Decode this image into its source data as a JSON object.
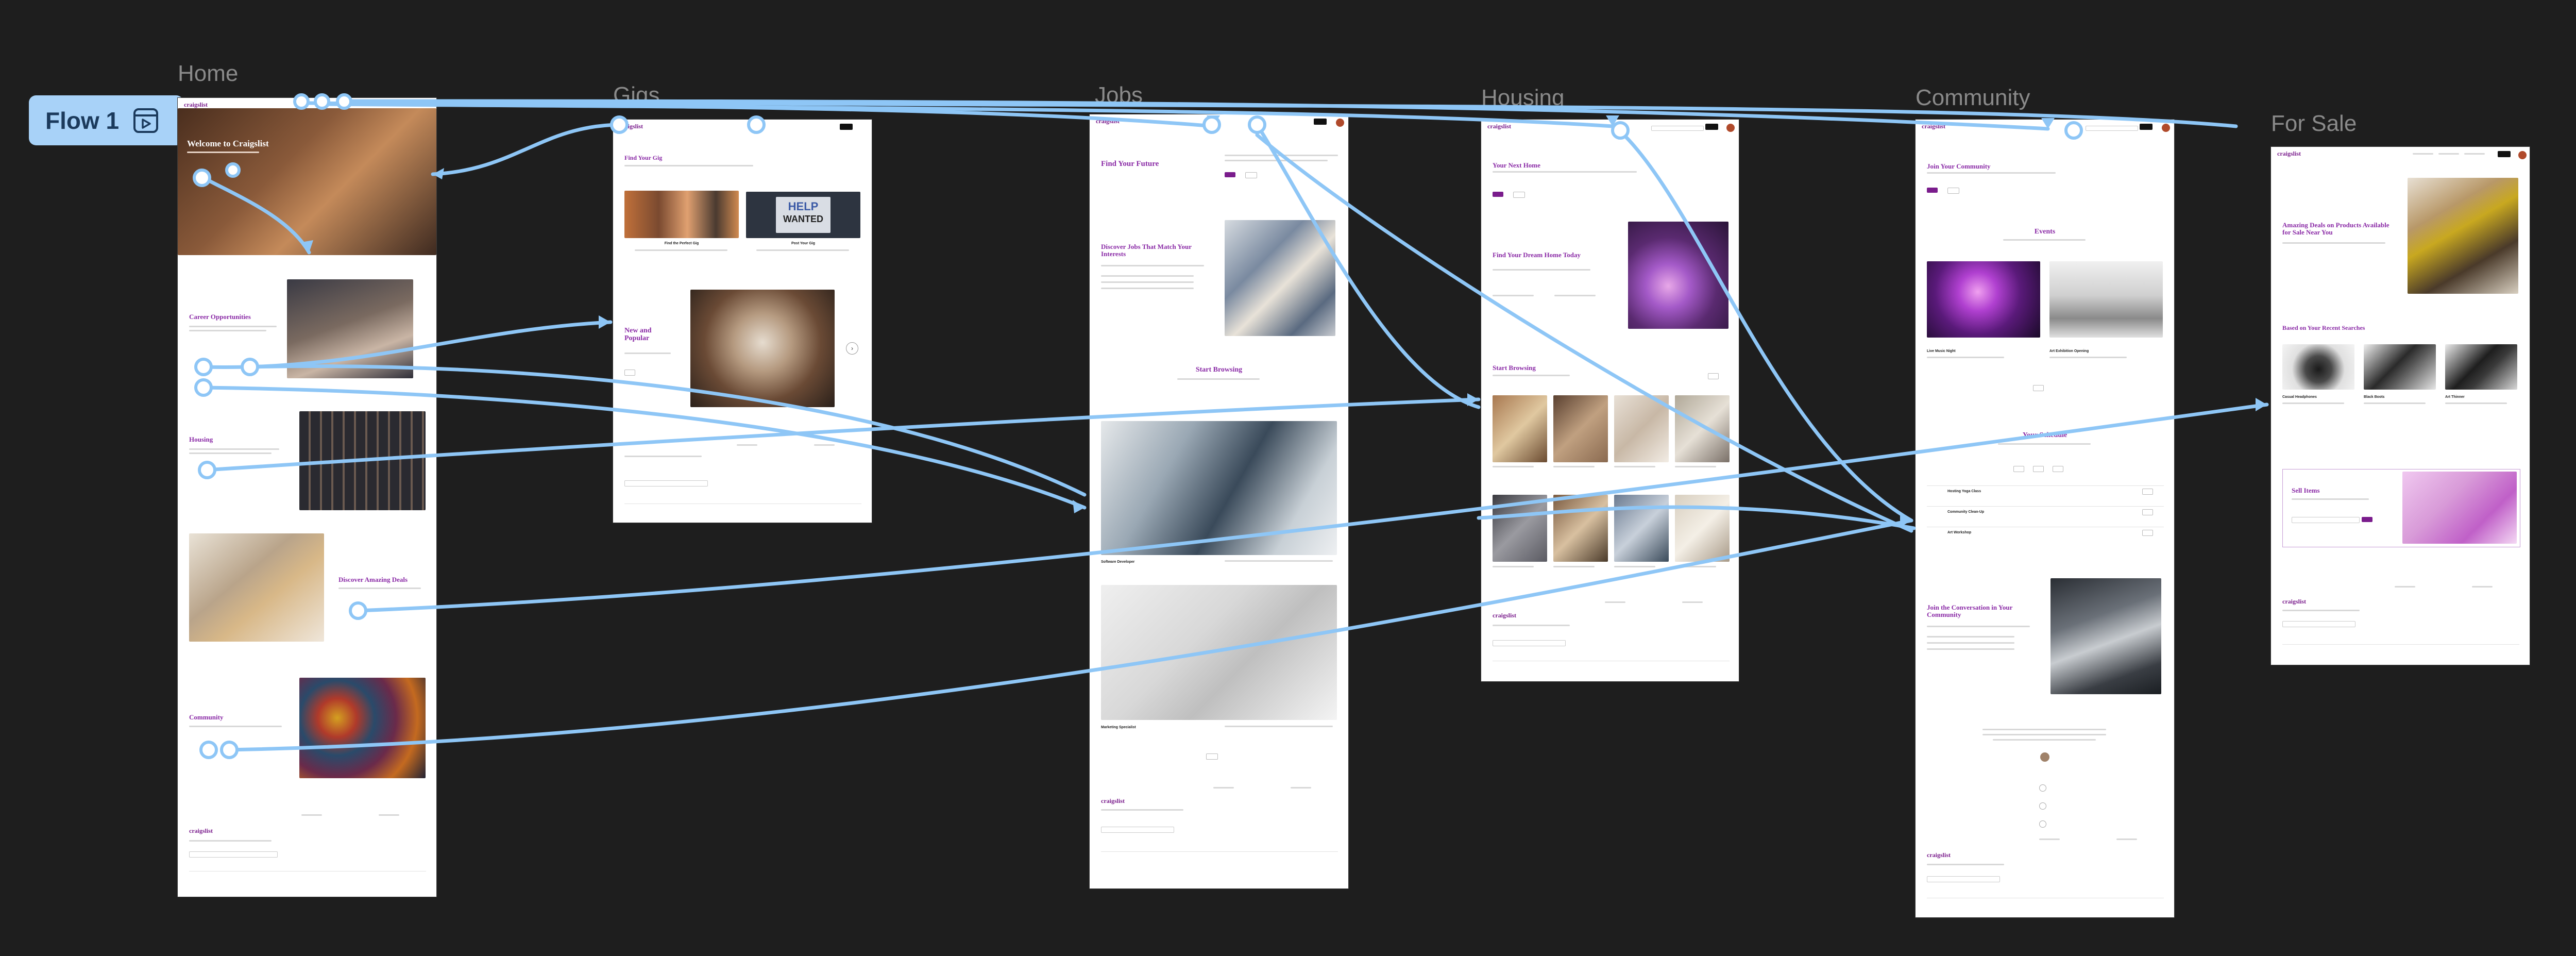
{
  "canvas": {
    "background": "#1e1e1e"
  },
  "flow": {
    "label": "Flow 1",
    "pill_color": "#a8d2f8",
    "icon": "play-flow-icon"
  },
  "frames": {
    "home": {
      "label": "Home",
      "logo": "craigslist",
      "hero_title": "Welcome to Craigslist",
      "sections": {
        "career": "Career Opportunities",
        "housing": "Housing",
        "deals": "Discover Amazing Deals",
        "community": "Community"
      },
      "footer_logo": "craigslist"
    },
    "gigs": {
      "label": "Gigs",
      "logo": "craigslist",
      "title": "Find Your Gig",
      "card1": "Find the Perfect Gig",
      "card2": "Post Your Gig",
      "help_sign_line1": "HELP",
      "help_sign_line2": "WANTED",
      "new_popular": "New and Popular"
    },
    "jobs": {
      "label": "Jobs",
      "logo": "craigslist",
      "title": "Find Your Future",
      "discover": "Discover Jobs That Match Your Interests",
      "browsing": "Start Browsing",
      "job1": "Software Developer",
      "job2": "Marketing Specialist",
      "footer_logo": "craigslist"
    },
    "housing": {
      "label": "Housing",
      "logo": "craigslist",
      "title": "Your Next Home",
      "dream": "Find Your Dream Home Today",
      "browsing": "Start Browsing",
      "footer_logo": "craigslist"
    },
    "community": {
      "label": "Community",
      "logo": "craigslist",
      "title": "Join Your Community",
      "events": "Events",
      "event1": "Live Music Night",
      "event2": "Art Exhibition Opening",
      "schedule": "Your Schedule",
      "schedule_rows": [
        "Hosting Yoga Class",
        "Community Clean-Up",
        "Art Workshop"
      ],
      "conversation": "Join the Conversation in Your Community",
      "footer_logo": "craigslist"
    },
    "for_sale": {
      "label": "For Sale",
      "logo": "craigslist",
      "title": "Amazing Deals on Products Available for Sale Near You",
      "recent": "Based on Your Recent Searches",
      "items": [
        "Casual Headphones",
        "Black Boots",
        "Art Thinner"
      ],
      "sell": "Sell Items",
      "footer_logo": "craigslist"
    }
  }
}
